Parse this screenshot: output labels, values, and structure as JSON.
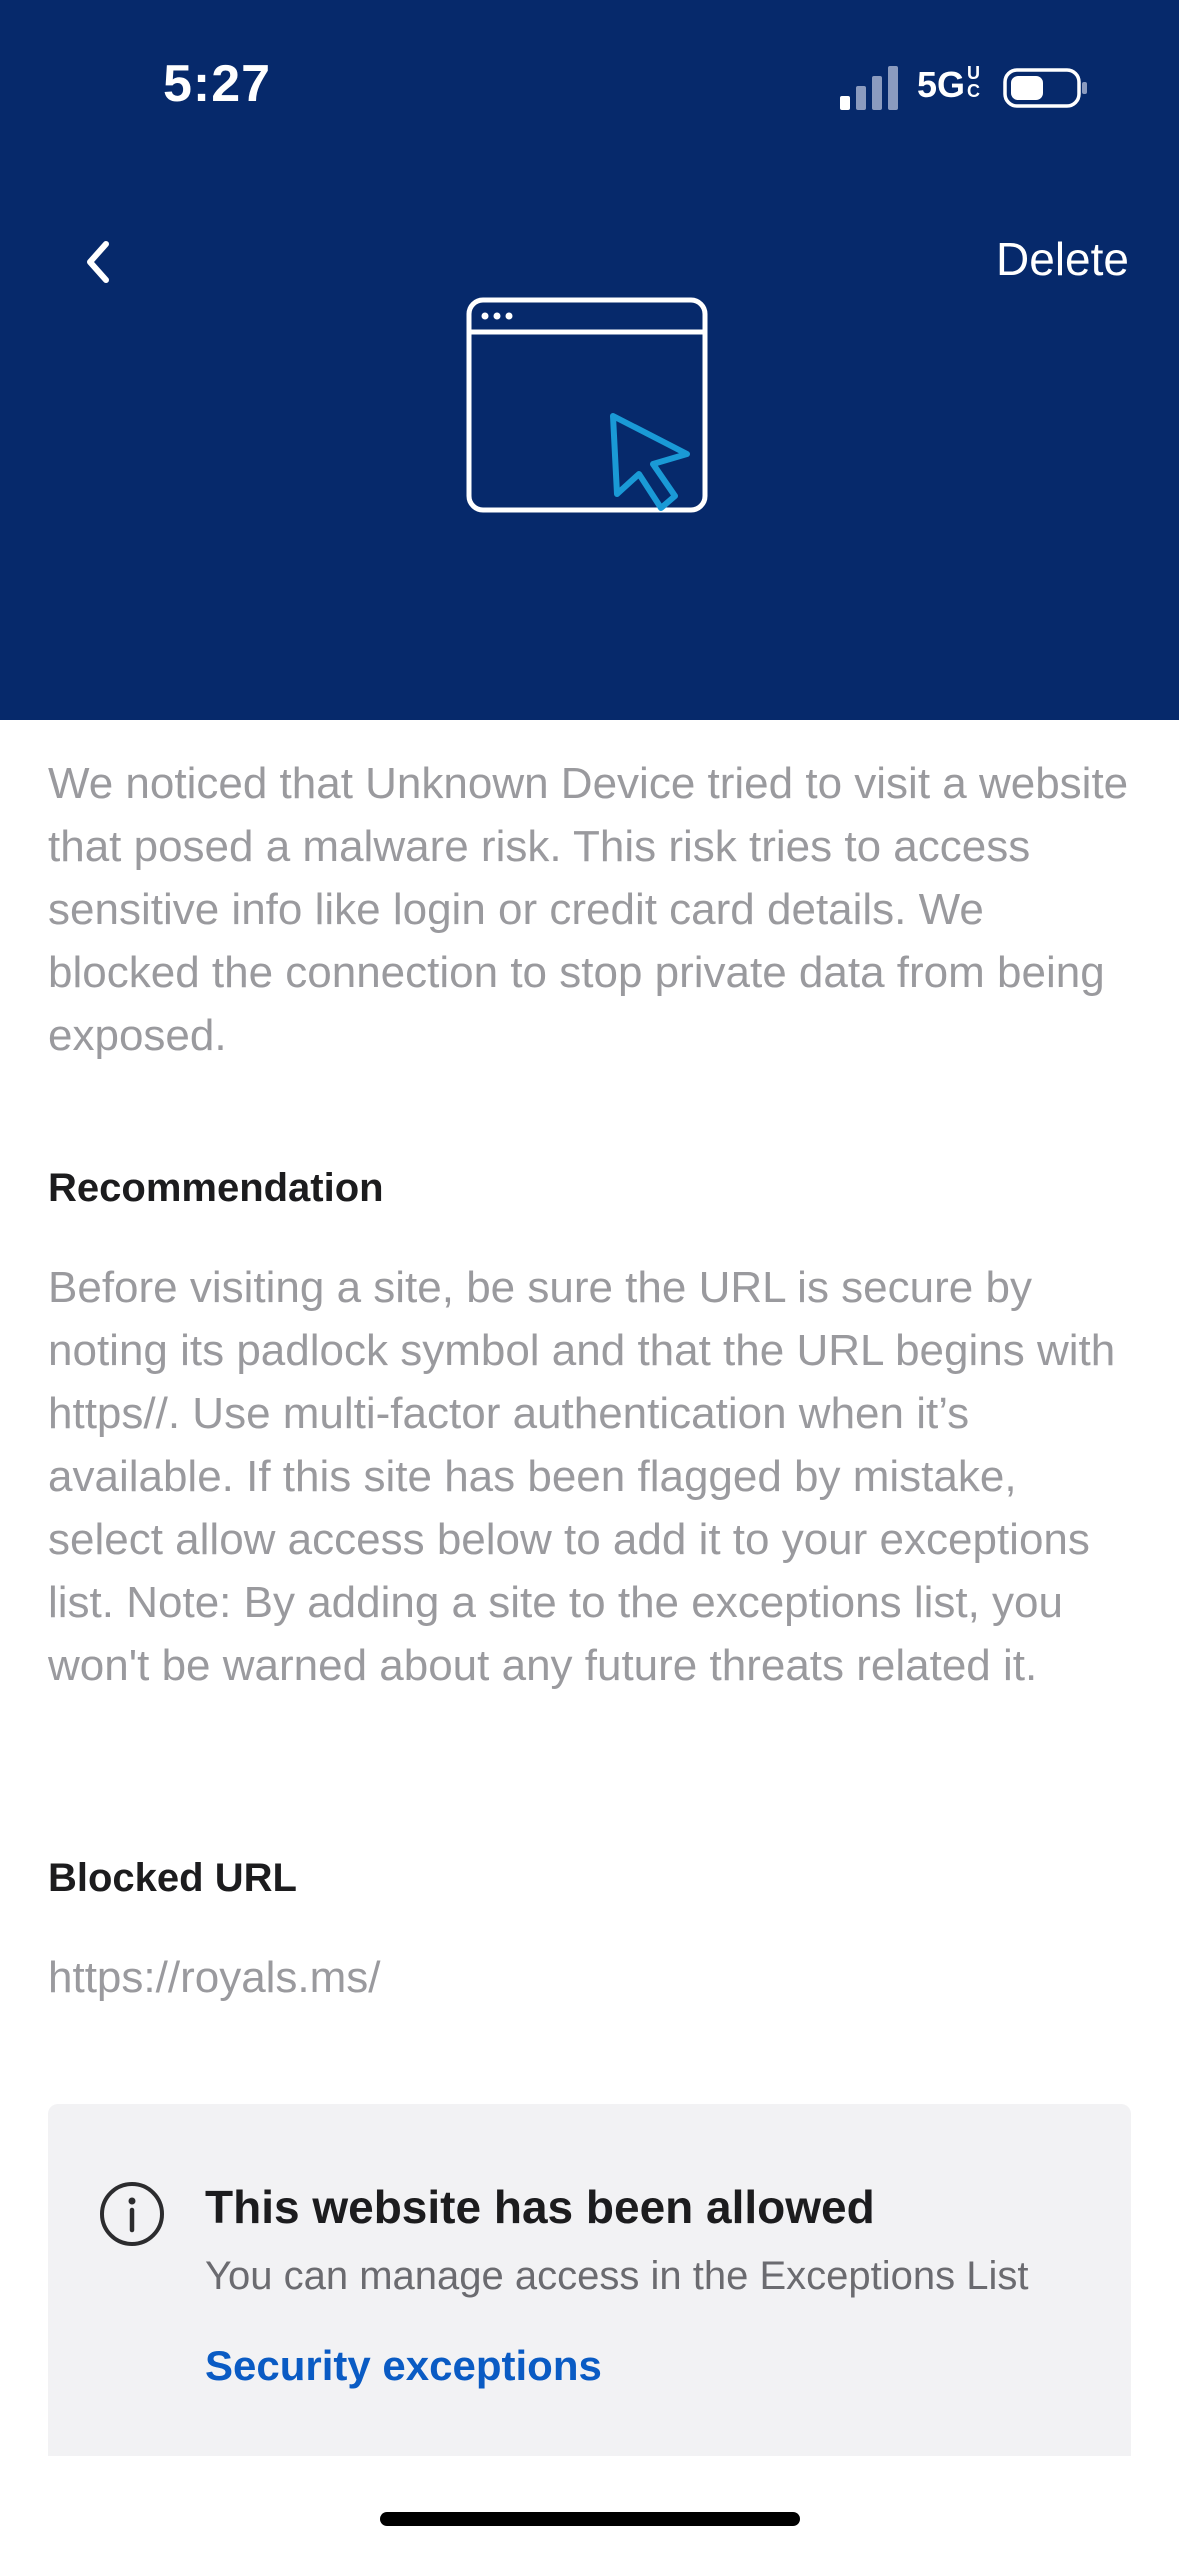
{
  "status_bar": {
    "time": "5:27",
    "network": "5G UC",
    "network_main": "5G",
    "network_sup": "UC",
    "signal_bars_filled": 1,
    "signal_bars_total": 4
  },
  "header": {
    "back_icon": "chevron-left-icon",
    "delete_label": "Delete",
    "hero_icon": "browser-window-cursor-icon",
    "background_color": "#06296b",
    "cursor_color": "#1a9ad6"
  },
  "description": "We noticed that Unknown Device tried to visit a website that posed a malware risk. This risk tries to access sensitive info like login or credit card details. We blocked the connection to stop private data from being exposed.",
  "recommendation": {
    "heading": "Recommendation",
    "text": "Before visiting a site, be sure the URL is secure by noting its padlock symbol and that the URL begins with https//. Use multi-factor authentication when it’s available. If this site has been flagged by mistake, select allow access below to add it to your exceptions list. Note: By adding a site to the exceptions list, you won't be warned about any future threats related it."
  },
  "blocked_url": {
    "heading": "Blocked URL",
    "value": "https://royals.ms/"
  },
  "notice": {
    "icon": "info-icon",
    "title": "This website has been allowed",
    "subtitle": "You can manage access in the Exceptions List",
    "link_label": "Security exceptions",
    "link_color": "#0a5bc4"
  }
}
